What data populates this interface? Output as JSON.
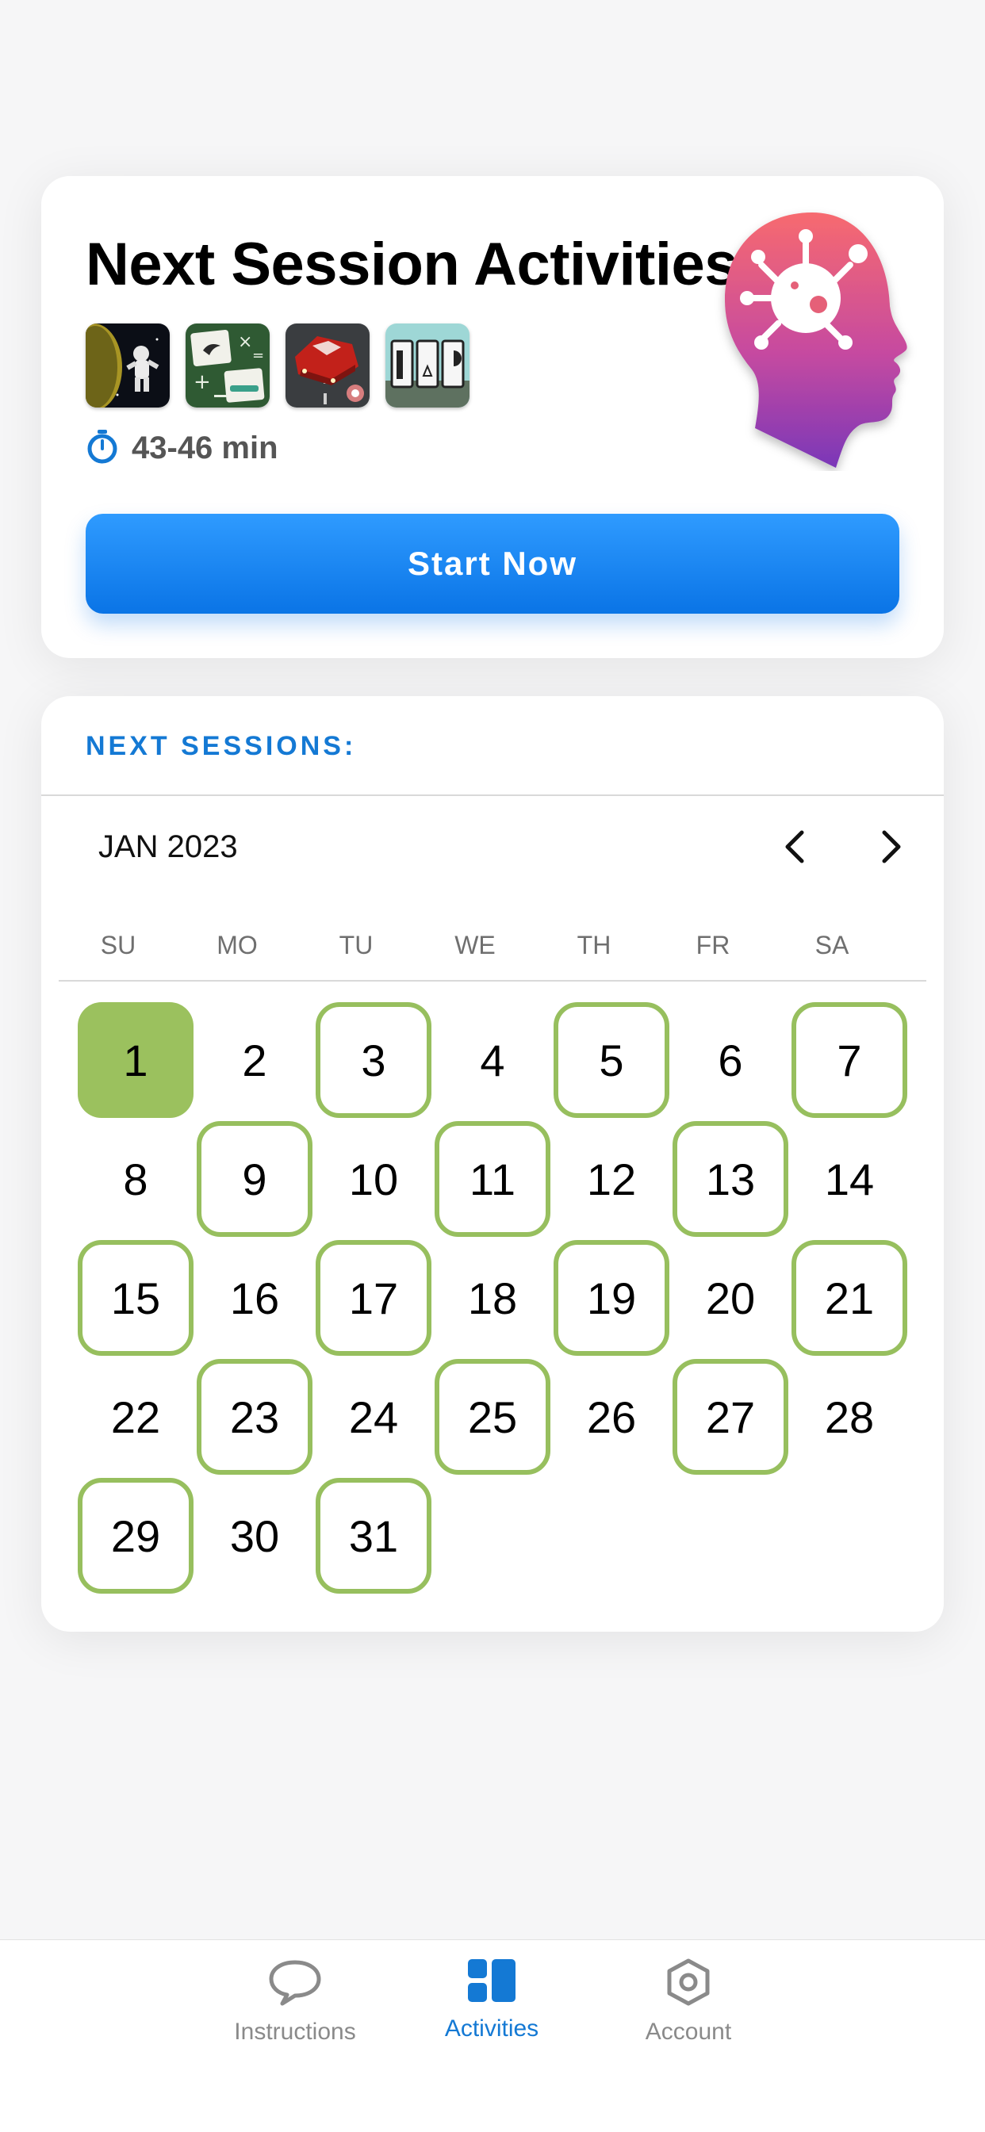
{
  "session_card": {
    "title": "Next Session Activities",
    "activities": [
      {
        "name": "astronaut-game-thumbnail"
      },
      {
        "name": "math-cards-game-thumbnail"
      },
      {
        "name": "car-driving-game-thumbnail"
      },
      {
        "name": "door-cards-game-thumbnail"
      }
    ],
    "duration": "43-46 min",
    "start_button": "Start Now",
    "colors": {
      "accent": "#1479d4",
      "button_top": "#2f9bff",
      "button_bottom": "#0a74e6"
    }
  },
  "calendar": {
    "section_title": "NEXT SESSIONS:",
    "month": "JAN 2023",
    "weekdays": [
      "SU",
      "MO",
      "TU",
      "WE",
      "TH",
      "FR",
      "SA"
    ],
    "today": 1,
    "session_days": [
      3,
      5,
      7,
      9,
      11,
      13,
      15,
      17,
      19,
      21,
      23,
      25,
      27,
      29,
      31
    ],
    "day_count": 31,
    "start_weekday": 0,
    "colors": {
      "session_outline": "#97bf5e",
      "today_fill": "#9bc15e"
    }
  },
  "tabbar": {
    "tabs": [
      {
        "label": "Instructions",
        "icon": "speech-bubble-icon"
      },
      {
        "label": "Activities",
        "icon": "grid-icon",
        "active": true
      },
      {
        "label": "Account",
        "icon": "hexagon-settings-icon"
      }
    ]
  }
}
